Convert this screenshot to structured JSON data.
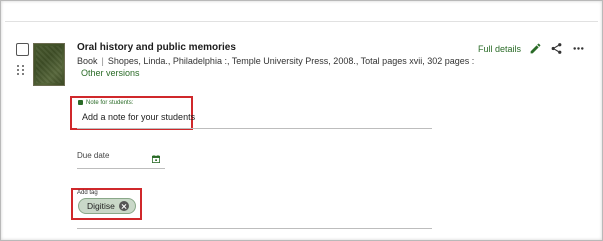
{
  "item": {
    "title": "Oral history and public memories",
    "type": "Book",
    "citation": "Shopes, Linda., Philadelphia :, Temple University Press, 2008., Total pages xvii, 302 pages :",
    "other_versions": "Other versions",
    "full_details": "Full details",
    "icons": [
      "pencil-icon",
      "share-icon",
      "more-horizontal-icon",
      "calendar-icon",
      "drag-handle-icon",
      "clear-tag-icon"
    ]
  },
  "note": {
    "label": "Note for students:",
    "placeholder": "Add a note for your students"
  },
  "due": {
    "label": "Due date"
  },
  "tags": {
    "label": "Add tag",
    "chips": [
      "Digitise"
    ]
  },
  "colors": {
    "accent": "#2a6b27",
    "highlight": "#d0282b",
    "chip_bg": "#c9d8c8"
  }
}
